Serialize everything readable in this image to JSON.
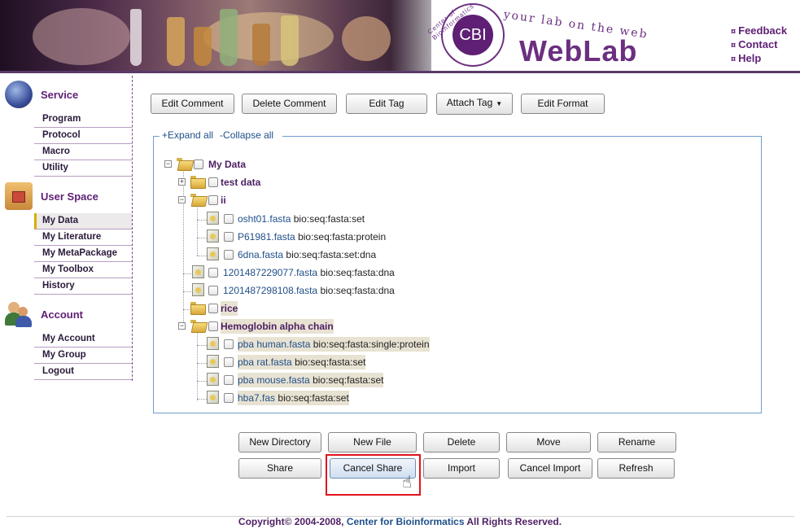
{
  "banner": {
    "tagline": "your lab on the web",
    "logo_text": "CBI",
    "logo_arc_text": "Center of Bioinformatics",
    "title": "WebLab",
    "links": [
      {
        "label": "Feedback",
        "icon": "bullet-icon"
      },
      {
        "label": "Contact",
        "icon": "bullet-icon"
      },
      {
        "label": "Help",
        "icon": "bullet-icon"
      }
    ]
  },
  "sidebar": {
    "sections": [
      {
        "title": "Service",
        "icon": "gear-globe-icon",
        "items": [
          "Program",
          "Protocol",
          "Macro",
          "Utility"
        ]
      },
      {
        "title": "User Space",
        "icon": "home-folder-icon",
        "items": [
          "My Data",
          "My Literature",
          "My MetaPackage",
          "My Toolbox",
          "History"
        ],
        "active": "My Data"
      },
      {
        "title": "Account",
        "icon": "users-icon",
        "items": [
          "My Account",
          "My Group",
          "Logout"
        ]
      }
    ]
  },
  "toolbar": {
    "edit_comment": "Edit Comment",
    "delete_comment": "Delete Comment",
    "edit_tag": "Edit Tag",
    "attach_tag": "Attach Tag",
    "edit_format": "Edit Format"
  },
  "tree": {
    "expand_all": "+Expand all",
    "collapse_all": "-Collapse all",
    "root": "My Data",
    "nodes": [
      {
        "name": "test data"
      },
      {
        "name": "ii"
      },
      {
        "name": "osht01.fasta",
        "format": "bio:seq:fasta:set"
      },
      {
        "name": "P61981.fasta",
        "format": "bio:seq:fasta:protein"
      },
      {
        "name": "6dna.fasta",
        "format": "bio:seq:fasta:set:dna"
      },
      {
        "name": "1201487229077.fasta",
        "format": "bio:seq:fasta:dna"
      },
      {
        "name": "1201487298108.fasta",
        "format": "bio:seq:fasta:dna"
      },
      {
        "name": "rice"
      },
      {
        "name": "Hemoglobin alpha chain"
      },
      {
        "name": "pba human.fasta",
        "format": "bio:seq:fasta:single:protein"
      },
      {
        "name": "pba rat.fasta",
        "format": "bio:seq:fasta:set"
      },
      {
        "name": "pba mouse.fasta",
        "format": "bio:seq:fasta:set"
      },
      {
        "name": "hba7.fas",
        "format": "bio:seq:fasta:set"
      }
    ]
  },
  "actions": {
    "new_directory": "New Directory",
    "new_file": "New File",
    "delete": "Delete",
    "move": "Move",
    "rename": "Rename",
    "share": "Share",
    "cancel_share": "Cancel Share",
    "import": "Import",
    "cancel_import": "Cancel Import",
    "refresh": "Refresh"
  },
  "footer": {
    "prefix": "Copyright© 2004-2008,",
    "link": "Center for Bioinformatics",
    "suffix": "All Rights Reserved."
  },
  "colors": {
    "brand_purple": "#5e1f74",
    "link_blue": "#1f4f8a",
    "tree_border": "#6d9fd0",
    "highlight_red": "#e0141e"
  }
}
